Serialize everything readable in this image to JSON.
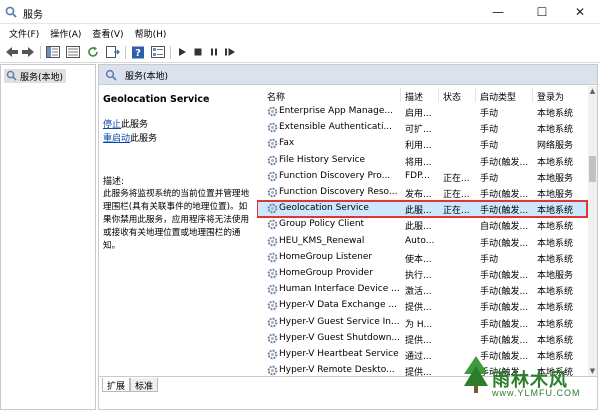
{
  "window": {
    "title": "服务",
    "minimize_glyph": "—",
    "maximize_glyph": "☐",
    "close_glyph": "✕"
  },
  "menu": [
    "文件(F)",
    "操作(A)",
    "查看(V)",
    "帮助(H)"
  ],
  "toolbar": {
    "icons": [
      "back-icon",
      "forward-icon",
      "show-tree-icon",
      "properties-icon",
      "refresh-icon",
      "export-list-icon",
      "help-icon",
      "properties-sheet-icon",
      "start-service-icon",
      "stop-service-icon",
      "pause-service-icon",
      "restart-service-icon"
    ]
  },
  "tree": {
    "node_label": "服务(本地)"
  },
  "pane": {
    "header_title": "服务(本地)",
    "service_name": "Geolocation Service",
    "stop_link": "停止",
    "stop_suffix": "此服务",
    "restart_link": "重启动",
    "restart_suffix": "此服务",
    "desc_label": "描述:",
    "desc_text": "此服务将监视系统的当前位置并管理地理围栏(具有关联事件的地理位置)。如果你禁用此服务，应用程序将无法使用或接收有关地理位置或地理围栏的通知。"
  },
  "columns": [
    "名称",
    "描述",
    "状态",
    "启动类型",
    "登录为"
  ],
  "rows": [
    {
      "name": "Enterprise App Manage...",
      "desc": "启用...",
      "status": "",
      "startup": "手动",
      "logon": "本地系统"
    },
    {
      "name": "Extensible Authenticati...",
      "desc": "可扩...",
      "status": "",
      "startup": "手动",
      "logon": "本地系统"
    },
    {
      "name": "Fax",
      "desc": "利用...",
      "status": "",
      "startup": "手动",
      "logon": "网络服务"
    },
    {
      "name": "File History Service",
      "desc": "将用...",
      "status": "",
      "startup": "手动(触发...",
      "logon": "本地系统"
    },
    {
      "name": "Function Discovery Pro...",
      "desc": "FDP...",
      "status": "正在...",
      "startup": "手动",
      "logon": "本地服务"
    },
    {
      "name": "Function Discovery Reso...",
      "desc": "发布...",
      "status": "正在...",
      "startup": "手动(触发...",
      "logon": "本地服务"
    },
    {
      "name": "Geolocation Service",
      "desc": "此服...",
      "status": "正在...",
      "startup": "手动(触发...",
      "logon": "本地系统",
      "selected": true
    },
    {
      "name": "Group Policy Client",
      "desc": "此服...",
      "status": "",
      "startup": "自动(触发...",
      "logon": "本地系统"
    },
    {
      "name": "HEU_KMS_Renewal",
      "desc": "Auto...",
      "status": "",
      "startup": "手动(触发...",
      "logon": "本地系统"
    },
    {
      "name": "HomeGroup Listener",
      "desc": "使本...",
      "status": "",
      "startup": "手动",
      "logon": "本地系统"
    },
    {
      "name": "HomeGroup Provider",
      "desc": "执行...",
      "status": "",
      "startup": "手动(触发...",
      "logon": "本地服务"
    },
    {
      "name": "Human Interface Device ...",
      "desc": "激活...",
      "status": "",
      "startup": "手动(触发...",
      "logon": "本地系统"
    },
    {
      "name": "Hyper-V Data Exchange ...",
      "desc": "提供...",
      "status": "",
      "startup": "手动(触发...",
      "logon": "本地系统"
    },
    {
      "name": "Hyper-V Guest Service In...",
      "desc": "为 H...",
      "status": "",
      "startup": "手动(触发...",
      "logon": "本地系统"
    },
    {
      "name": "Hyper-V Guest Shutdown...",
      "desc": "提供...",
      "status": "",
      "startup": "手动(触发...",
      "logon": "本地系统"
    },
    {
      "name": "Hyper-V Heartbeat Service",
      "desc": "通过...",
      "status": "",
      "startup": "手动(触发...",
      "logon": "本地系统"
    },
    {
      "name": "Hyper-V Remote Deskto...",
      "desc": "提供...",
      "status": "",
      "startup": "手动(触发...",
      "logon": "本地系统"
    }
  ],
  "tabs": [
    "扩展",
    "标准"
  ],
  "watermark": {
    "brand": "雨林木风",
    "url": "www.YLMFU.COM"
  },
  "colors": {
    "selection_bg": "#cce8ff",
    "selection_border": "#e53333",
    "link": "#0645ad",
    "pane_header": "#dbe2ee"
  }
}
